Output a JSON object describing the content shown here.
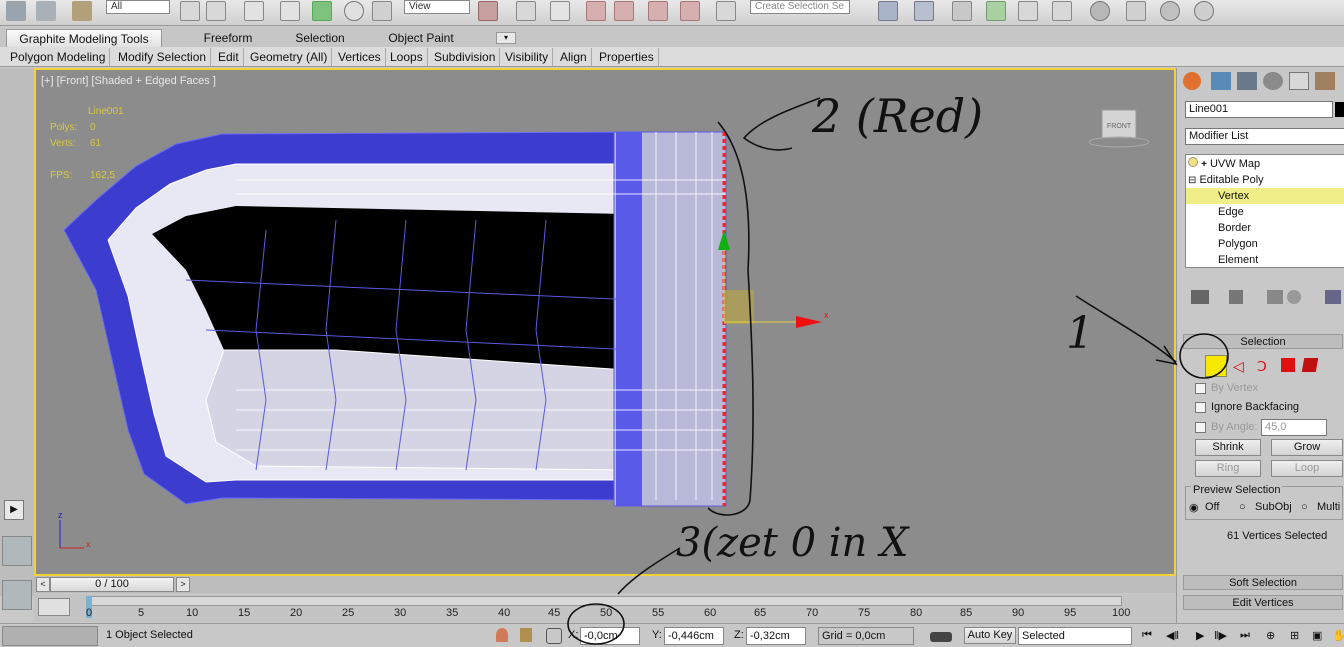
{
  "toolbar": {
    "filter_value": "All",
    "view_value": "View",
    "selection_set_placeholder": "Create Selection Se"
  },
  "ribbon": {
    "tabs": [
      "Graphite Modeling Tools",
      "Freeform",
      "Selection",
      "Object Paint"
    ],
    "subtabs": [
      "Polygon Modeling",
      "Modify Selection",
      "Edit",
      "Geometry (All)",
      "Vertices",
      "Loops",
      "Subdivision",
      "Visibility",
      "Align",
      "Properties"
    ]
  },
  "viewport": {
    "label": "[+] [Front] [Shaded + Edged Faces ]",
    "object_name": "Line001",
    "polys_label": "Polys:",
    "polys_value": "0",
    "verts_label": "Verts:",
    "verts_value": "61",
    "fps_label": "FPS:",
    "fps_value": "162,5",
    "viewcube_label": "FRONT",
    "axis_z": "z",
    "axis_x": "x",
    "gizmo_x": "x"
  },
  "annotations": {
    "note_1": "1",
    "note_2": "2 (Red)",
    "note_3": "3(zet 0 in X"
  },
  "command_panel": {
    "object_name": "Line001",
    "modifier_list": "Modifier List",
    "stack": [
      {
        "label": "UVW Map"
      },
      {
        "label": "Editable Poly"
      },
      {
        "label": "Vertex"
      },
      {
        "label": "Edge"
      },
      {
        "label": "Border"
      },
      {
        "label": "Polygon"
      },
      {
        "label": "Element"
      }
    ],
    "selection_title": "Selection",
    "by_vertex": "By Vertex",
    "ignore_backfacing": "Ignore Backfacing",
    "by_angle": "By Angle:",
    "angle_value": "45,0",
    "shrink": "Shrink",
    "grow": "Grow",
    "ring": "Ring",
    "loop": "Loop",
    "preview_selection": "Preview Selection",
    "preview_off": "Off",
    "preview_subobj": "SubObj",
    "preview_multi": "Multi",
    "selected_count": "61 Vertices Selected",
    "soft_selection": "Soft Selection",
    "edit_vertices": "Edit Vertices"
  },
  "timeline": {
    "frame_display": "0 / 100",
    "ticks": [
      "0",
      "5",
      "10",
      "15",
      "20",
      "25",
      "30",
      "35",
      "40",
      "45",
      "50",
      "55",
      "60",
      "65",
      "70",
      "75",
      "80",
      "85",
      "90",
      "95",
      "100"
    ]
  },
  "status": {
    "selection_text": "1 Object Selected",
    "x_label": "X:",
    "x_value": "-0,0cm",
    "y_label": "Y:",
    "y_value": "-0,446cm",
    "z_label": "Z:",
    "z_value": "-0,32cm",
    "grid": "Grid = 0,0cm",
    "auto_key": "Auto Key",
    "key_mode": "Selected"
  },
  "colors": {
    "viewport_border": "#f2d236",
    "selected_vertex": "#ff2020",
    "mesh_blue": "#4a4ae6",
    "highlight_row": "#f0ee88"
  }
}
